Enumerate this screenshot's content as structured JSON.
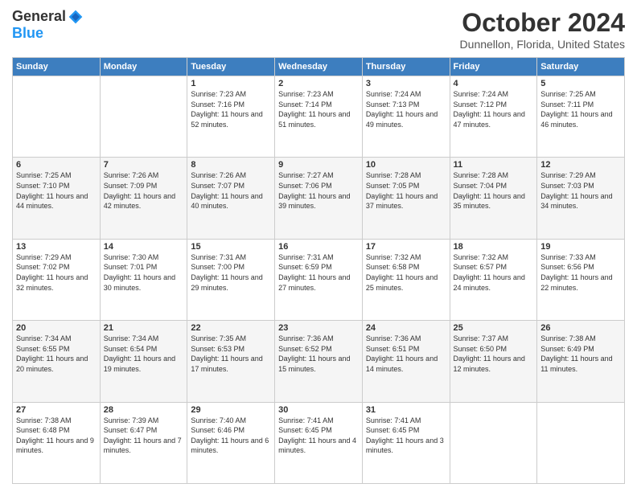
{
  "logo": {
    "general": "General",
    "blue": "Blue"
  },
  "header": {
    "month": "October 2024",
    "location": "Dunnellon, Florida, United States"
  },
  "weekdays": [
    "Sunday",
    "Monday",
    "Tuesday",
    "Wednesday",
    "Thursday",
    "Friday",
    "Saturday"
  ],
  "weeks": [
    [
      {
        "day": "",
        "sunrise": "",
        "sunset": "",
        "daylight": ""
      },
      {
        "day": "",
        "sunrise": "",
        "sunset": "",
        "daylight": ""
      },
      {
        "day": "1",
        "sunrise": "Sunrise: 7:23 AM",
        "sunset": "Sunset: 7:16 PM",
        "daylight": "Daylight: 11 hours and 52 minutes."
      },
      {
        "day": "2",
        "sunrise": "Sunrise: 7:23 AM",
        "sunset": "Sunset: 7:14 PM",
        "daylight": "Daylight: 11 hours and 51 minutes."
      },
      {
        "day": "3",
        "sunrise": "Sunrise: 7:24 AM",
        "sunset": "Sunset: 7:13 PM",
        "daylight": "Daylight: 11 hours and 49 minutes."
      },
      {
        "day": "4",
        "sunrise": "Sunrise: 7:24 AM",
        "sunset": "Sunset: 7:12 PM",
        "daylight": "Daylight: 11 hours and 47 minutes."
      },
      {
        "day": "5",
        "sunrise": "Sunrise: 7:25 AM",
        "sunset": "Sunset: 7:11 PM",
        "daylight": "Daylight: 11 hours and 46 minutes."
      }
    ],
    [
      {
        "day": "6",
        "sunrise": "Sunrise: 7:25 AM",
        "sunset": "Sunset: 7:10 PM",
        "daylight": "Daylight: 11 hours and 44 minutes."
      },
      {
        "day": "7",
        "sunrise": "Sunrise: 7:26 AM",
        "sunset": "Sunset: 7:09 PM",
        "daylight": "Daylight: 11 hours and 42 minutes."
      },
      {
        "day": "8",
        "sunrise": "Sunrise: 7:26 AM",
        "sunset": "Sunset: 7:07 PM",
        "daylight": "Daylight: 11 hours and 40 minutes."
      },
      {
        "day": "9",
        "sunrise": "Sunrise: 7:27 AM",
        "sunset": "Sunset: 7:06 PM",
        "daylight": "Daylight: 11 hours and 39 minutes."
      },
      {
        "day": "10",
        "sunrise": "Sunrise: 7:28 AM",
        "sunset": "Sunset: 7:05 PM",
        "daylight": "Daylight: 11 hours and 37 minutes."
      },
      {
        "day": "11",
        "sunrise": "Sunrise: 7:28 AM",
        "sunset": "Sunset: 7:04 PM",
        "daylight": "Daylight: 11 hours and 35 minutes."
      },
      {
        "day": "12",
        "sunrise": "Sunrise: 7:29 AM",
        "sunset": "Sunset: 7:03 PM",
        "daylight": "Daylight: 11 hours and 34 minutes."
      }
    ],
    [
      {
        "day": "13",
        "sunrise": "Sunrise: 7:29 AM",
        "sunset": "Sunset: 7:02 PM",
        "daylight": "Daylight: 11 hours and 32 minutes."
      },
      {
        "day": "14",
        "sunrise": "Sunrise: 7:30 AM",
        "sunset": "Sunset: 7:01 PM",
        "daylight": "Daylight: 11 hours and 30 minutes."
      },
      {
        "day": "15",
        "sunrise": "Sunrise: 7:31 AM",
        "sunset": "Sunset: 7:00 PM",
        "daylight": "Daylight: 11 hours and 29 minutes."
      },
      {
        "day": "16",
        "sunrise": "Sunrise: 7:31 AM",
        "sunset": "Sunset: 6:59 PM",
        "daylight": "Daylight: 11 hours and 27 minutes."
      },
      {
        "day": "17",
        "sunrise": "Sunrise: 7:32 AM",
        "sunset": "Sunset: 6:58 PM",
        "daylight": "Daylight: 11 hours and 25 minutes."
      },
      {
        "day": "18",
        "sunrise": "Sunrise: 7:32 AM",
        "sunset": "Sunset: 6:57 PM",
        "daylight": "Daylight: 11 hours and 24 minutes."
      },
      {
        "day": "19",
        "sunrise": "Sunrise: 7:33 AM",
        "sunset": "Sunset: 6:56 PM",
        "daylight": "Daylight: 11 hours and 22 minutes."
      }
    ],
    [
      {
        "day": "20",
        "sunrise": "Sunrise: 7:34 AM",
        "sunset": "Sunset: 6:55 PM",
        "daylight": "Daylight: 11 hours and 20 minutes."
      },
      {
        "day": "21",
        "sunrise": "Sunrise: 7:34 AM",
        "sunset": "Sunset: 6:54 PM",
        "daylight": "Daylight: 11 hours and 19 minutes."
      },
      {
        "day": "22",
        "sunrise": "Sunrise: 7:35 AM",
        "sunset": "Sunset: 6:53 PM",
        "daylight": "Daylight: 11 hours and 17 minutes."
      },
      {
        "day": "23",
        "sunrise": "Sunrise: 7:36 AM",
        "sunset": "Sunset: 6:52 PM",
        "daylight": "Daylight: 11 hours and 15 minutes."
      },
      {
        "day": "24",
        "sunrise": "Sunrise: 7:36 AM",
        "sunset": "Sunset: 6:51 PM",
        "daylight": "Daylight: 11 hours and 14 minutes."
      },
      {
        "day": "25",
        "sunrise": "Sunrise: 7:37 AM",
        "sunset": "Sunset: 6:50 PM",
        "daylight": "Daylight: 11 hours and 12 minutes."
      },
      {
        "day": "26",
        "sunrise": "Sunrise: 7:38 AM",
        "sunset": "Sunset: 6:49 PM",
        "daylight": "Daylight: 11 hours and 11 minutes."
      }
    ],
    [
      {
        "day": "27",
        "sunrise": "Sunrise: 7:38 AM",
        "sunset": "Sunset: 6:48 PM",
        "daylight": "Daylight: 11 hours and 9 minutes."
      },
      {
        "day": "28",
        "sunrise": "Sunrise: 7:39 AM",
        "sunset": "Sunset: 6:47 PM",
        "daylight": "Daylight: 11 hours and 7 minutes."
      },
      {
        "day": "29",
        "sunrise": "Sunrise: 7:40 AM",
        "sunset": "Sunset: 6:46 PM",
        "daylight": "Daylight: 11 hours and 6 minutes."
      },
      {
        "day": "30",
        "sunrise": "Sunrise: 7:41 AM",
        "sunset": "Sunset: 6:45 PM",
        "daylight": "Daylight: 11 hours and 4 minutes."
      },
      {
        "day": "31",
        "sunrise": "Sunrise: 7:41 AM",
        "sunset": "Sunset: 6:45 PM",
        "daylight": "Daylight: 11 hours and 3 minutes."
      },
      {
        "day": "",
        "sunrise": "",
        "sunset": "",
        "daylight": ""
      },
      {
        "day": "",
        "sunrise": "",
        "sunset": "",
        "daylight": ""
      }
    ]
  ]
}
